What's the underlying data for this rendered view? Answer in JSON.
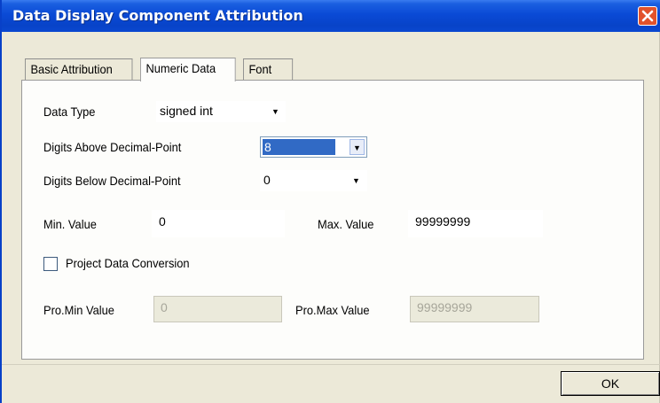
{
  "window": {
    "title": "Data Display Component Attribution"
  },
  "tabs": [
    {
      "label": "Basic Attribution",
      "active": false
    },
    {
      "label": "Numeric Data",
      "active": true
    },
    {
      "label": "Font",
      "active": false
    }
  ],
  "form": {
    "data_type": {
      "label": "Data Type",
      "value": "signed int"
    },
    "digits_above": {
      "label": "Digits Above Decimal-Point",
      "value": "8"
    },
    "digits_below": {
      "label": "Digits Below Decimal-Point",
      "value": "0"
    },
    "min_value": {
      "label": "Min. Value",
      "value": "0"
    },
    "max_value": {
      "label": "Max. Value",
      "value": "99999999"
    },
    "project_conversion": {
      "label": "Project Data Conversion",
      "checked": false
    },
    "pro_min": {
      "label": "Pro.Min Value",
      "value": "0"
    },
    "pro_max": {
      "label": "Pro.Max Value",
      "value": "99999999"
    }
  },
  "buttons": {
    "ok_label": "OK"
  },
  "icons": {
    "close": "close-icon",
    "dropdown": "chevron-down-icon"
  },
  "colors": {
    "titlebar": "#0a4ad6",
    "close_button": "#e2522b",
    "selection": "#316ac5",
    "dialog_bg": "#ece9d8"
  }
}
